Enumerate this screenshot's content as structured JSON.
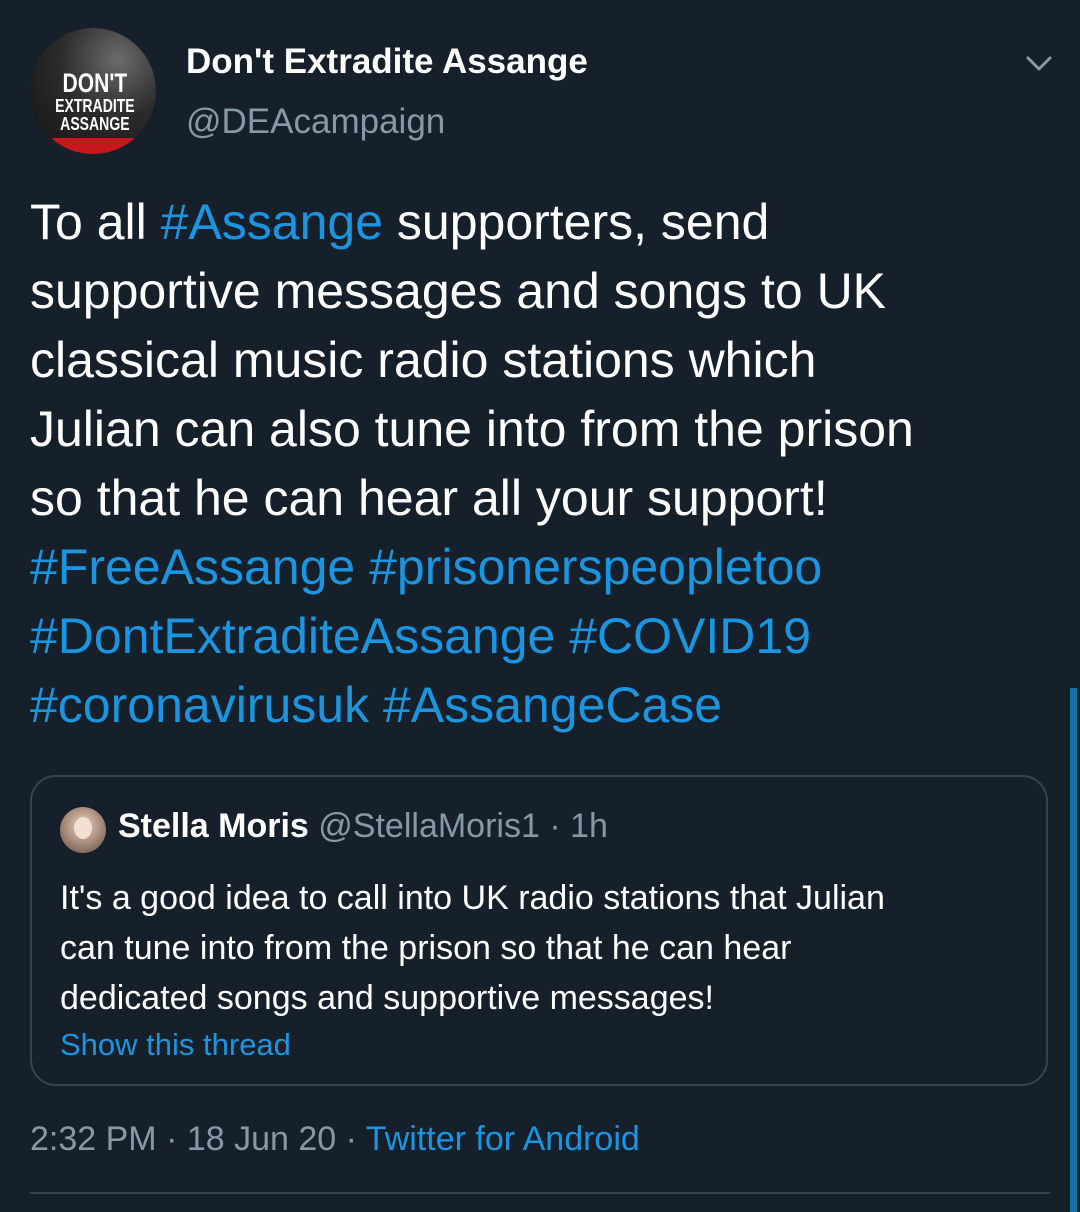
{
  "tweet": {
    "avatar_logo": {
      "line1": "DON'T",
      "line2": "EXTRADITE",
      "line3": "ASSANGE"
    },
    "display_name": "Don't Extradite Assange",
    "handle": "@DEAcampaign",
    "menu_icon": "chevron-down-icon",
    "lines": [
      {
        "segments": [
          {
            "text": "To all ",
            "hashtag": false
          },
          {
            "text": "#Assange",
            "hashtag": true
          },
          {
            "text": " supporters, send",
            "hashtag": false
          }
        ]
      },
      {
        "segments": [
          {
            "text": "supportive messages and songs to UK",
            "hashtag": false
          }
        ]
      },
      {
        "segments": [
          {
            "text": "classical music radio stations which",
            "hashtag": false
          }
        ]
      },
      {
        "segments": [
          {
            "text": "Julian can also tune into from the prison",
            "hashtag": false
          }
        ]
      },
      {
        "segments": [
          {
            "text": "so that he can hear all your support!",
            "hashtag": false
          }
        ]
      },
      {
        "segments": [
          {
            "text": "#FreeAssange",
            "hashtag": true
          },
          {
            "text": " ",
            "hashtag": false
          },
          {
            "text": "#prisonerspeopletoo",
            "hashtag": true
          }
        ]
      },
      {
        "segments": [
          {
            "text": "#DontExtraditeAssange",
            "hashtag": true
          },
          {
            "text": " ",
            "hashtag": false
          },
          {
            "text": "#COVID19",
            "hashtag": true
          }
        ]
      },
      {
        "segments": [
          {
            "text": "#coronavirusuk",
            "hashtag": true
          },
          {
            "text": " ",
            "hashtag": false
          },
          {
            "text": "#AssangeCase",
            "hashtag": true
          }
        ]
      }
    ],
    "quote": {
      "name": "Stella Moris",
      "handle_time": " @StellaMoris1 · 1h",
      "body_lines": [
        "It's a good idea to call into UK radio stations that Julian",
        "can tune into from the prison so that he can hear",
        "dedicated songs and supportive messages!"
      ],
      "show_thread": "Show this thread"
    },
    "timestamp": "2:32 PM · 18 Jun 20 · ",
    "source": "Twitter for Android"
  },
  "colors": {
    "background": "#15202b",
    "text": "#ffffff",
    "muted": "#8899a6",
    "link": "#1b95e0",
    "border": "#38444d"
  }
}
